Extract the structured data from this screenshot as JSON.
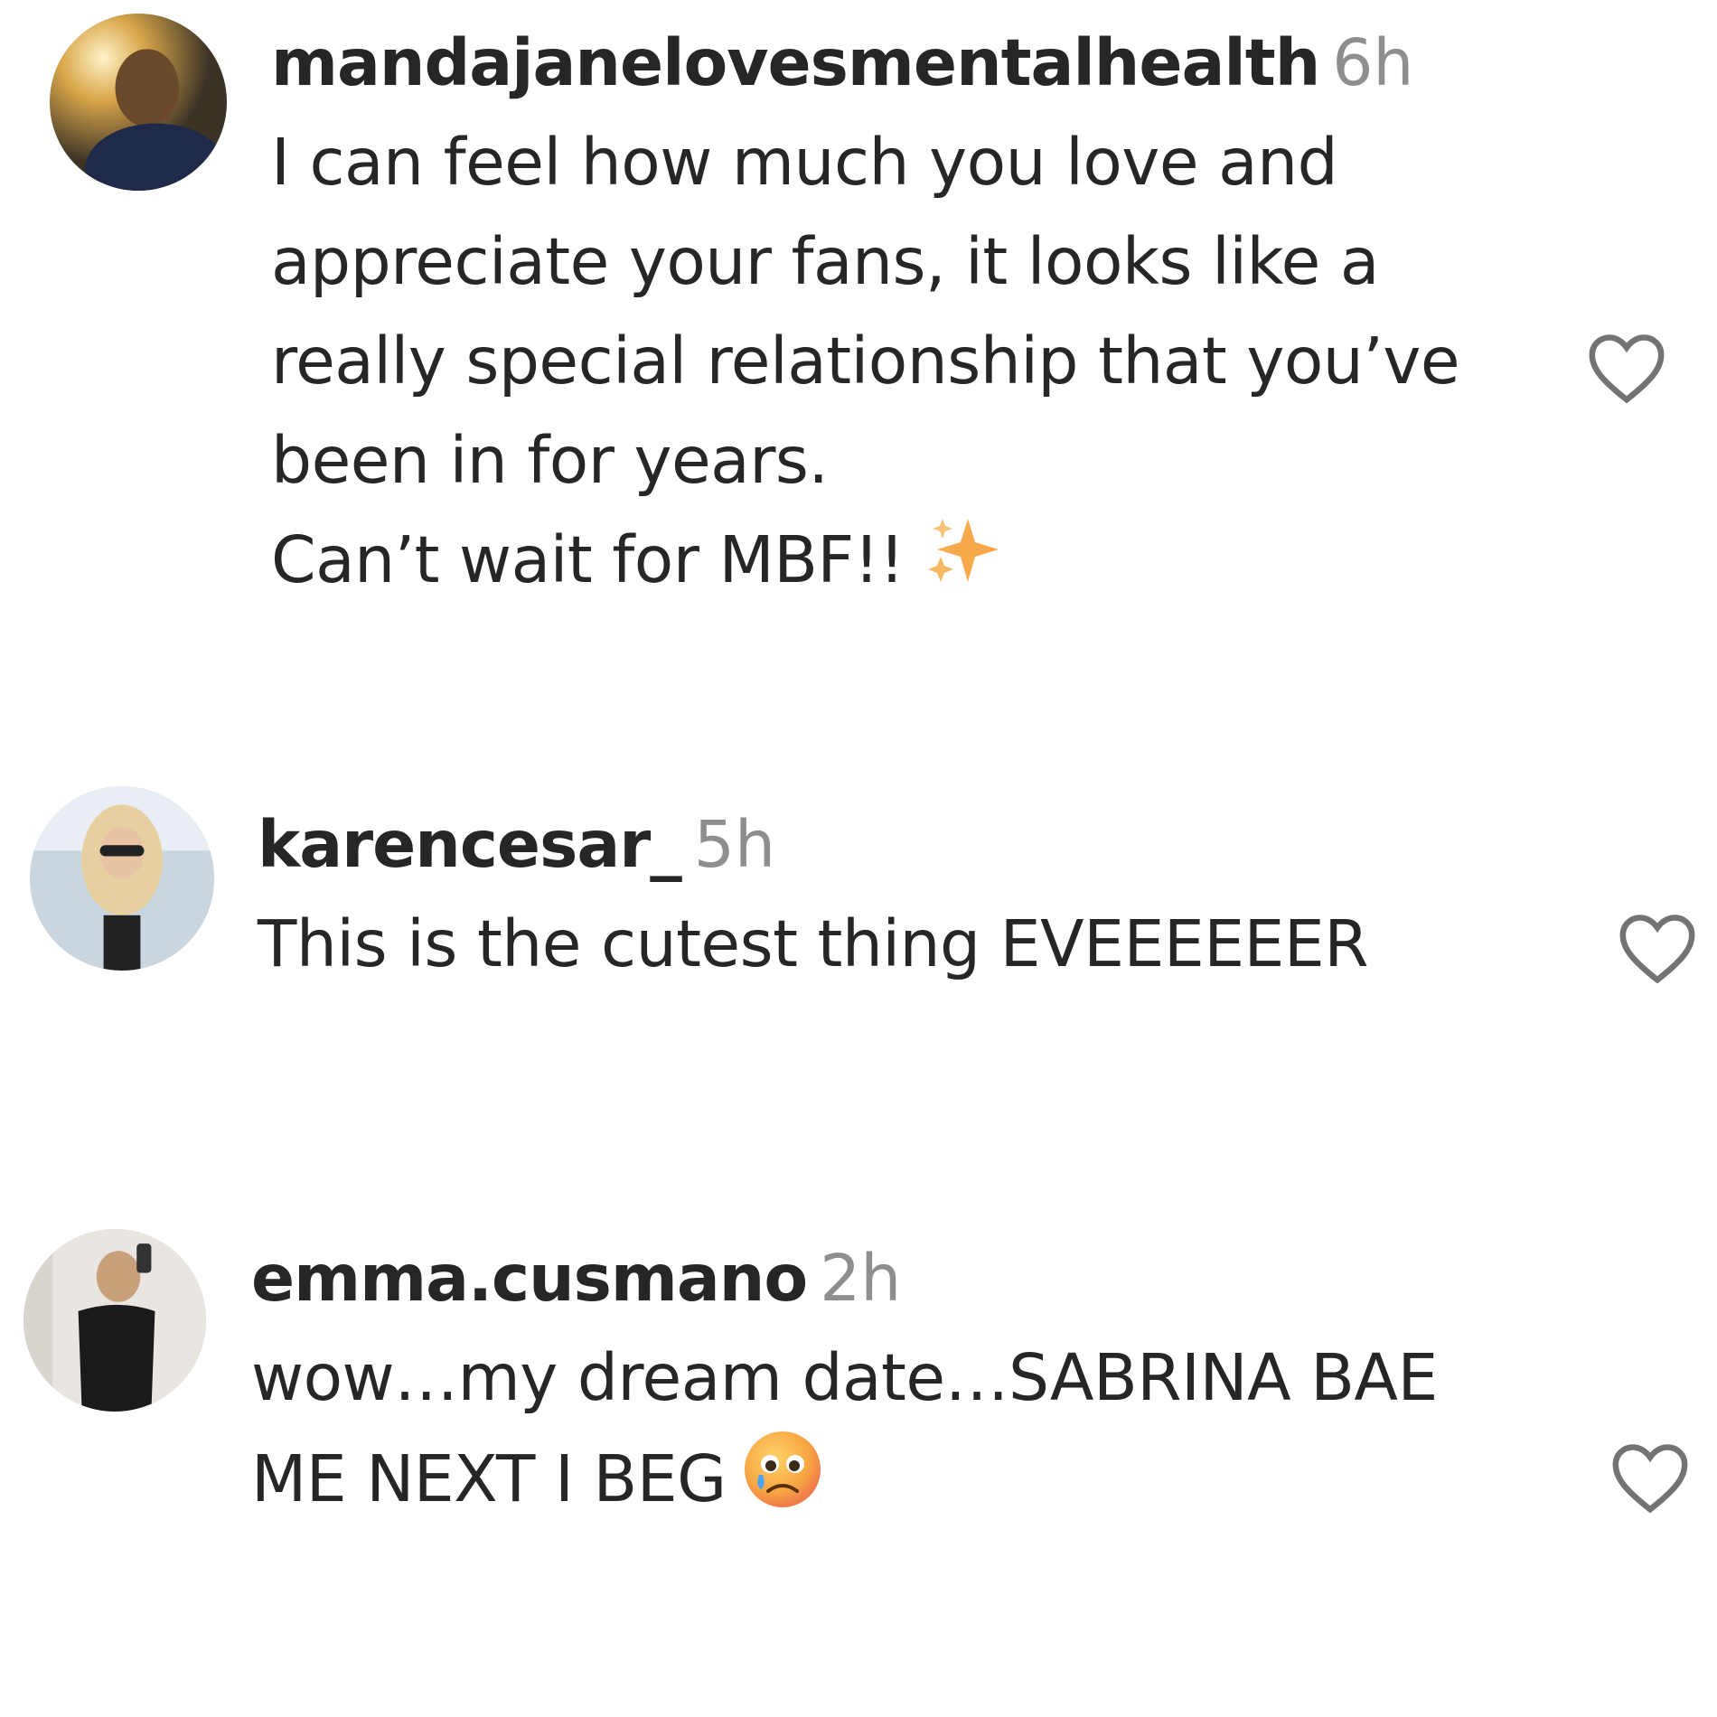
{
  "comments": [
    {
      "username": "mandajanelovesmentalhealth",
      "time": "6h",
      "lines": [
        "I can feel how much you love and",
        "appreciate your fans, it looks like a",
        "really special relationship that you’ve",
        "been in for years.",
        "Can’t wait for MBF!!"
      ],
      "emoji": "sparkles-emoji"
    },
    {
      "username": "karencesar_",
      "time": "5h",
      "lines": [
        "This is the cutest thing EVEEEEEER"
      ]
    },
    {
      "username": "emma.cusmano",
      "time": "2h",
      "lines": [
        "wow…my dream date…SABRINA BAE",
        "ME NEXT I BEG"
      ],
      "emoji": "crying-face-emoji"
    }
  ],
  "icons": {
    "like": "heart-outline-icon"
  },
  "colors": {
    "text": "#262626",
    "secondary": "#8e8e8e",
    "background": "#ffffff"
  }
}
